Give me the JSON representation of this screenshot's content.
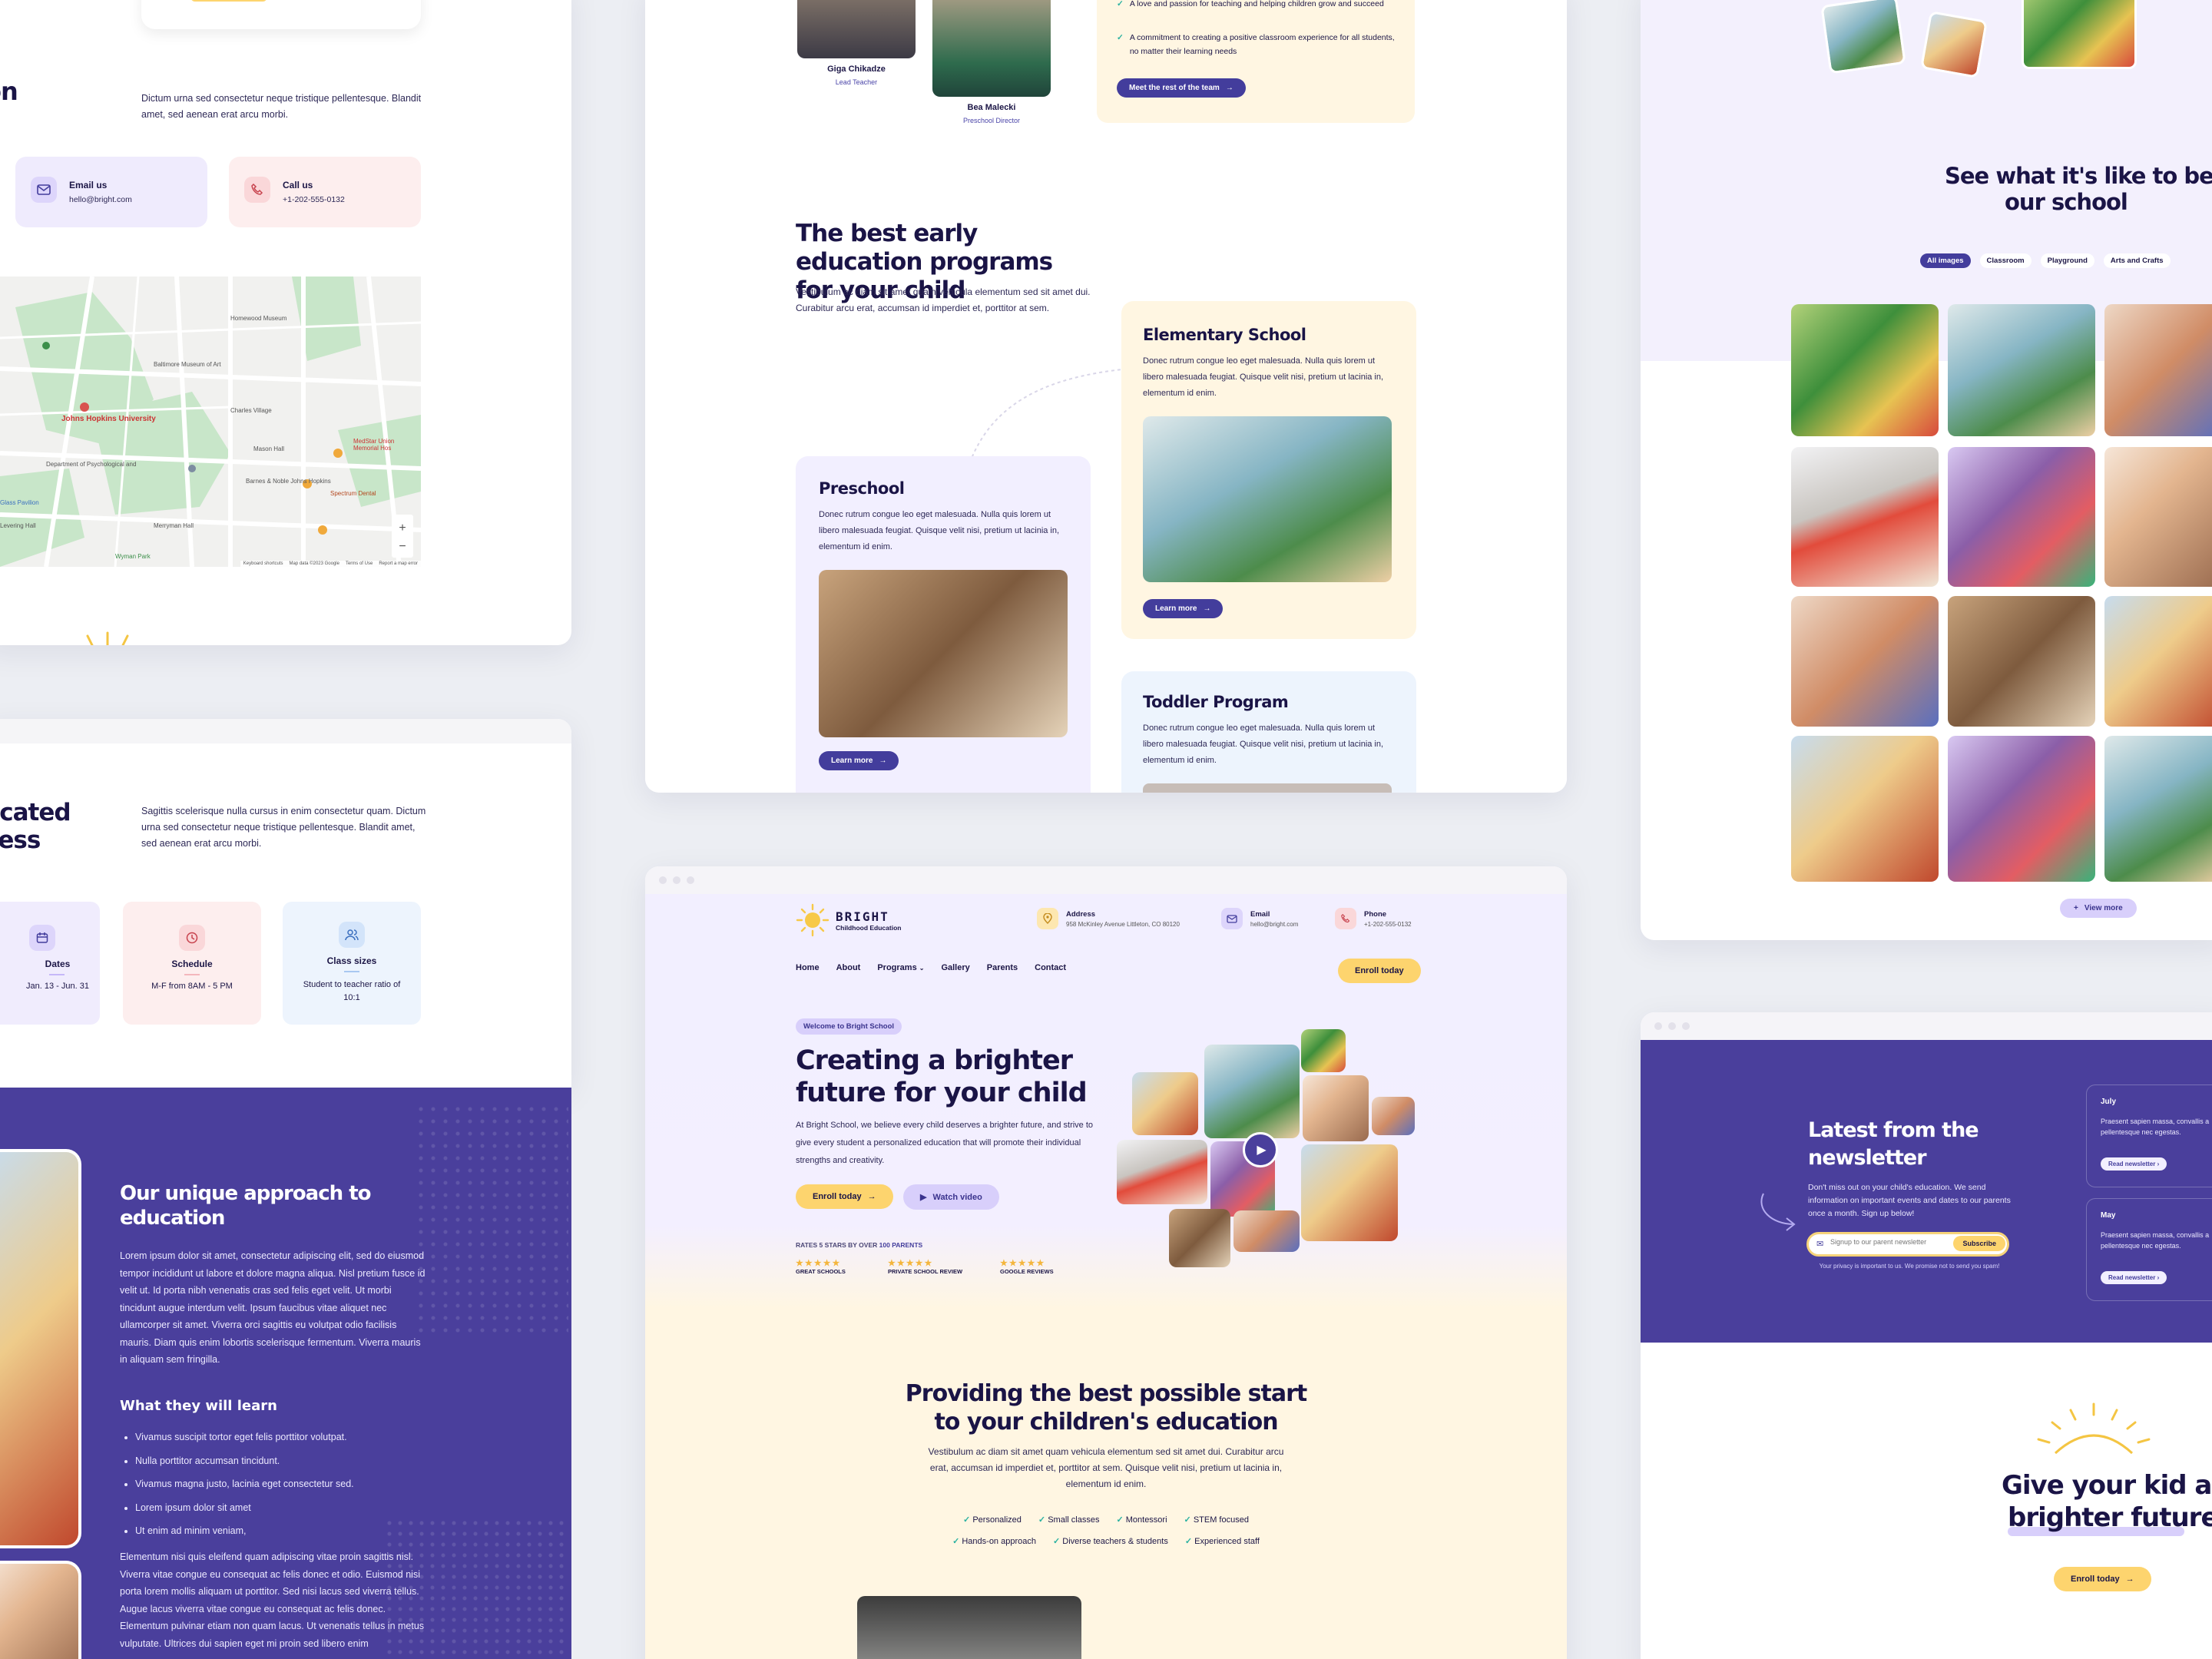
{
  "contact_panel": {
    "title_fragment": "on",
    "intro": "Dictum urna sed consectetur neque tristique pellentesque. Blandit amet, sed aenean erat arcu morbi.",
    "email": {
      "label": "Email us",
      "value": "hello@bright.com"
    },
    "call": {
      "label": "Call us",
      "value": "+1-202-555-0132"
    },
    "map_labels": [
      "Johns Hopkins University",
      "Homewood Museum",
      "Barnes & Noble Johns Hopkins",
      "Department of Psychological and",
      "Glass Pavilion",
      "Merryman Hall",
      "Spectrum Dental",
      "MedStar Union Memorial Hos",
      "Levering Hall",
      "Mason Hall",
      "Baltimore Museum of Art",
      "Wyman Park",
      "Charles Village",
      "Keyboard shortcuts",
      "Map data ©2023 Google",
      "Terms of Use",
      "Report a map error"
    ]
  },
  "schedule_panel": {
    "title_line1": "licated",
    "title_line2": "cess",
    "intro": "Sagittis scelerisque nulla cursus in enim consectetur quam. Dictum urna sed consectetur neque tristique pellentesque. Blandit amet, sed aenean erat arcu morbi.",
    "cards": [
      {
        "label": "Dates",
        "value": "Jan. 13 - Jun. 31",
        "color": "#f0ecfd"
      },
      {
        "label": "Schedule",
        "value": "M-F from 8AM - 5 PM",
        "color": "#fdeeee"
      },
      {
        "label": "Class sizes",
        "value": "Student to teacher ratio of 10:1",
        "color": "#edf4fd"
      }
    ]
  },
  "approach_panel": {
    "title": "Our unique approach to education",
    "body": "Lorem ipsum dolor sit amet, consectetur adipiscing elit, sed do eiusmod tempor incididunt ut labore et dolore magna aliqua. Nisl pretium fusce id velit ut. Id porta nibh venenatis cras sed felis eget velit. Ut morbi tincidunt augue interdum velit. Ipsum faucibus vitae aliquet nec ullamcorper sit amet. Viverra orci sagittis eu volutpat odio facilisis mauris. Diam quis enim lobortis scelerisque fermentum. Viverra mauris in aliquam sem fringilla.",
    "learn_title": "What they will learn",
    "learn_items": [
      "Vivamus suscipit tortor eget felis porttitor volutpat.",
      "Nulla porttitor accumsan tincidunt.",
      "Vivamus magna justo, lacinia eget consectetur sed.",
      "Lorem ipsum dolor sit amet",
      "Ut enim ad minim veniam,"
    ],
    "body2": "Elementum nisi quis eleifend quam adipiscing vitae proin sagittis nisl. Viverra vitae congue eu consequat ac felis donec et odio. Euismod nisi porta lorem mollis aliquam ut porttitor. Sed nisi lacus sed viverra tellus. Augue lacus viverra vitae congue eu consequat ac felis donec. Elementum pulvinar etiam non quam lacus. Ut venenatis tellus in metus vulputate. Ultrices dui sapien eget mi proin sed libero enim"
  },
  "team_panel": {
    "members": [
      {
        "name": "Giga Chikadze",
        "role": "Lead Teacher"
      },
      {
        "name": "Bea Malecki",
        "role": "Preschool Director"
      }
    ],
    "points": [
      "A love and passion for teaching and helping children grow and succeed",
      "A commitment to creating a positive classroom experience for all students, no matter their learning needs"
    ],
    "team_button": "Meet the rest of the team"
  },
  "programs_panel": {
    "title": "The best early education programs for your child",
    "intro": "Vestibulum ac diam sit amet quam vehicula elementum sed sit amet dui. Curabitur arcu erat, accumsan id imperdiet et, porttitor at sem.",
    "cards": [
      {
        "title": "Elementary School",
        "body": "Donec rutrum congue leo eget malesuada. Nulla quis lorem ut libero malesuada feugiat. Quisque velit nisi, pretium ut lacinia in, elementum id enim.",
        "button": "Learn more"
      },
      {
        "title": "Preschool",
        "body": "Donec rutrum congue leo eget malesuada. Nulla quis lorem ut libero malesuada feugiat. Quisque velit nisi, pretium ut lacinia in, elementum id enim.",
        "button": "Learn more"
      },
      {
        "title": "Toddler Program",
        "body": "Donec rutrum congue leo eget malesuada. Nulla quis lorem ut libero malesuada feugiat. Quisque velit nisi, pretium ut lacinia in, elementum id enim."
      }
    ]
  },
  "home_panel": {
    "logo": {
      "name": "BRIGHT",
      "sub": "Childhood Education"
    },
    "contacts": [
      {
        "label": "Address",
        "value": "958 McKinley Avenue Littleton, CO 80120"
      },
      {
        "label": "Email",
        "value": "hello@bright.com"
      },
      {
        "label": "Phone",
        "value": "+1-202-555-0132"
      }
    ],
    "nav": [
      "Home",
      "About",
      "Programs",
      "Gallery",
      "Parents",
      "Contact"
    ],
    "enroll_button": "Enroll today",
    "badge": "Welcome to Bright School",
    "hero_title": "Creating a brighter future for your child",
    "hero_body": "At Bright School, we believe every child deserves a brighter future, and strive to give every student a personalized education that will promote their individual strengths and creativity.",
    "hero_enroll": "Enroll today",
    "hero_video": "Watch video",
    "rating_prefix": "RATES 5 STARS BY OVER",
    "rating_count": "100 PARENTS",
    "reviews": [
      "GREAT SCHOOLS",
      "PRIVATE SCHOOL REVIEW",
      "GOOGLE REVIEWS"
    ],
    "start_title": "Providing the best possible start to your children's education",
    "start_body": "Vestibulum ac diam sit amet quam vehicula elementum sed sit amet dui. Curabitur arcu erat, accumsan id imperdiet et, porttitor at sem. Quisque velit nisi, pretium ut lacinia in, elementum id enim.",
    "features_row1": [
      "Personalized",
      "Small classes",
      "Montessori",
      "STEM focused"
    ],
    "features_row2": [
      "Hands-on approach",
      "Diverse teachers & students",
      "Experienced staff"
    ]
  },
  "gallery_panel": {
    "title": "See what it's like to be pa our school",
    "title_line1": "See what it's like to be pa",
    "title_line2": "our school",
    "filters": [
      "All images",
      "Classroom",
      "Playground",
      "Arts and Crafts"
    ],
    "view_more": "View more"
  },
  "newsletter_panel": {
    "title": "Latest from the newsletter",
    "body": "Don't miss out on your child's education. We send information on important events and dates to our parents once a month. Sign up below!",
    "placeholder": "Signup to our parent newsletter",
    "subscribe": "Subscribe",
    "privacy": "Your privacy is important to us. We promise not to send you spam!",
    "posts": [
      {
        "month": "July",
        "body": "Praesent sapien massa, convallis a pellentesque nec egestas.",
        "button": "Read newsletter"
      },
      {
        "month": "May",
        "body": "Praesent sapien massa, convallis a pellentesque nec egestas.",
        "button": "Read newsletter"
      }
    ]
  },
  "cta_panel": {
    "title_line1": "Give your kid a",
    "title_line2": "brighter future",
    "button": "Enroll today"
  },
  "colors": {
    "primary": "#433d9c",
    "accent": "#fdd46e",
    "lavender": "#f2efff",
    "cream": "#fff6e2"
  }
}
